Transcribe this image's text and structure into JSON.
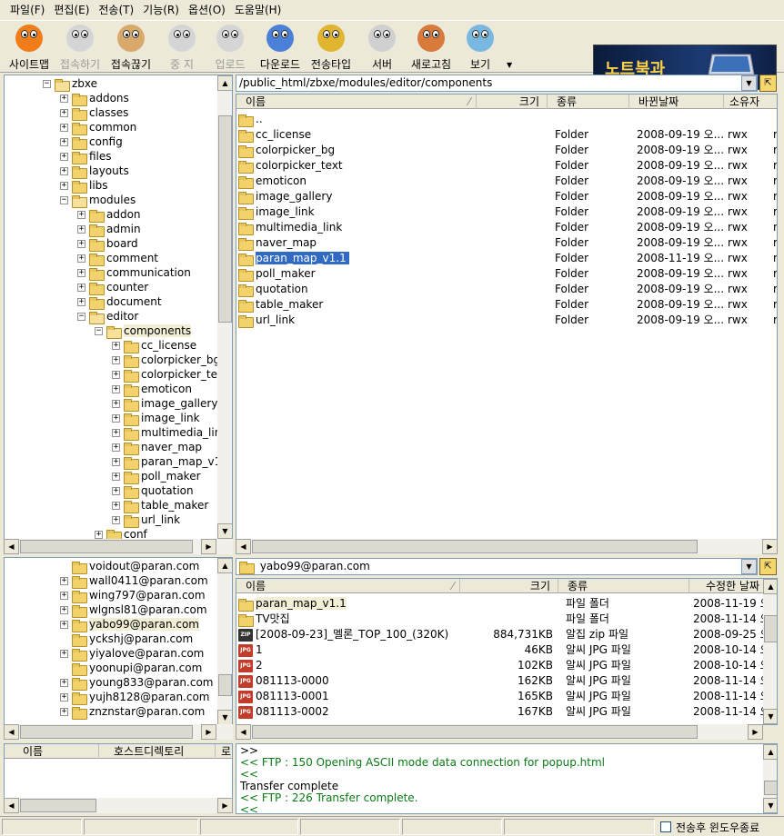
{
  "menu": [
    "파일(F)",
    "편집(E)",
    "전송(T)",
    "기능(R)",
    "옵션(O)",
    "도움말(H)"
  ],
  "toolbar": {
    "buttons": [
      {
        "label": "사이트맵",
        "color": "#f07c1a",
        "disabled": false
      },
      {
        "label": "접속하기",
        "color": "#9a9a9a",
        "disabled": true
      },
      {
        "label": "접속끊기",
        "color": "#d9a86b",
        "disabled": false
      },
      {
        "label": "중 지",
        "color": "#9a9a9a",
        "disabled": true
      },
      {
        "label": "업로드",
        "color": "#9a9a9a",
        "disabled": true
      },
      {
        "label": "다운로드",
        "color": "#4a80d8",
        "disabled": false
      },
      {
        "label": "전송타입",
        "color": "#e2b530",
        "disabled": false
      },
      {
        "label": "서버",
        "color": "#d0d0d0",
        "disabled": false
      },
      {
        "label": "새로고침",
        "color": "#d77a3c",
        "disabled": false
      },
      {
        "label": "보기",
        "color": "#79b8e0",
        "disabled": false
      }
    ],
    "banner_text": "노트북과"
  },
  "remote_tree": [
    {
      "label": "zbxe",
      "expanded": true,
      "twisty": "−"
    },
    {
      "label": "addons",
      "twisty": "+"
    },
    {
      "label": "classes",
      "twisty": "+"
    },
    {
      "label": "common",
      "twisty": "+"
    },
    {
      "label": "config",
      "twisty": "+"
    },
    {
      "label": "files",
      "twisty": "+"
    },
    {
      "label": "layouts",
      "twisty": "+"
    },
    {
      "label": "libs",
      "twisty": "+"
    },
    {
      "label": "modules",
      "twisty": "−"
    },
    {
      "label": "addon",
      "twisty": "+"
    },
    {
      "label": "admin",
      "twisty": "+"
    },
    {
      "label": "board",
      "twisty": "+"
    },
    {
      "label": "comment",
      "twisty": "+"
    },
    {
      "label": "communication",
      "twisty": "+"
    },
    {
      "label": "counter",
      "twisty": "+"
    },
    {
      "label": "document",
      "twisty": "+"
    },
    {
      "label": "editor",
      "twisty": "−"
    },
    {
      "label": "components",
      "twisty": "−"
    },
    {
      "label": "cc_license",
      "twisty": "+"
    },
    {
      "label": "colorpicker_bg",
      "twisty": "+"
    },
    {
      "label": "colorpicker_te",
      "twisty": "+"
    },
    {
      "label": "emoticon",
      "twisty": "+"
    },
    {
      "label": "image_gallery",
      "twisty": "+"
    },
    {
      "label": "image_link",
      "twisty": "+"
    },
    {
      "label": "multimedia_lir",
      "twisty": "+"
    },
    {
      "label": "naver_map",
      "twisty": "+"
    },
    {
      "label": "paran_map_v1",
      "twisty": "+"
    },
    {
      "label": "poll_maker",
      "twisty": "+"
    },
    {
      "label": "quotation",
      "twisty": "+"
    },
    {
      "label": "table_maker",
      "twisty": "+"
    },
    {
      "label": "url_link",
      "twisty": "+"
    },
    {
      "label": "conf",
      "twisty": "+"
    }
  ],
  "remote_path": "/public_html/zbxe/modules/editor/components",
  "remote_headers": [
    "이름",
    "크기",
    "종류",
    "바뀐날짜",
    "소유자"
  ],
  "remote_files": [
    {
      "name": "..",
      "type": "",
      "date": "",
      "perm": "",
      "extra": ""
    },
    {
      "name": "cc_license",
      "type": "Folder",
      "date": "2008-09-19 오...",
      "perm": "rwx",
      "extra": "r-"
    },
    {
      "name": "colorpicker_bg",
      "type": "Folder",
      "date": "2008-09-19 오...",
      "perm": "rwx",
      "extra": "r-"
    },
    {
      "name": "colorpicker_text",
      "type": "Folder",
      "date": "2008-09-19 오...",
      "perm": "rwx",
      "extra": "r-"
    },
    {
      "name": "emoticon",
      "type": "Folder",
      "date": "2008-09-19 오...",
      "perm": "rwx",
      "extra": "r-"
    },
    {
      "name": "image_gallery",
      "type": "Folder",
      "date": "2008-09-19 오...",
      "perm": "rwx",
      "extra": "r-"
    },
    {
      "name": "image_link",
      "type": "Folder",
      "date": "2008-09-19 오...",
      "perm": "rwx",
      "extra": "r-"
    },
    {
      "name": "multimedia_link",
      "type": "Folder",
      "date": "2008-09-19 오...",
      "perm": "rwx",
      "extra": "r-"
    },
    {
      "name": "naver_map",
      "type": "Folder",
      "date": "2008-09-19 오...",
      "perm": "rwx",
      "extra": "r-"
    },
    {
      "name": "paran_map_v1.1",
      "type": "Folder",
      "date": "2008-11-19 오...",
      "perm": "rwx",
      "extra": "r-"
    },
    {
      "name": "poll_maker",
      "type": "Folder",
      "date": "2008-09-19 오...",
      "perm": "rwx",
      "extra": "r-"
    },
    {
      "name": "quotation",
      "type": "Folder",
      "date": "2008-09-19 오...",
      "perm": "rwx",
      "extra": "r-"
    },
    {
      "name": "table_maker",
      "type": "Folder",
      "date": "2008-09-19 오...",
      "perm": "rwx",
      "extra": "r-"
    },
    {
      "name": "url_link",
      "type": "Folder",
      "date": "2008-09-19 오...",
      "perm": "rwx",
      "extra": "r-"
    }
  ],
  "remote_selected": 9,
  "local_tree": [
    {
      "label": "voidout@paran.com",
      "twisty": ""
    },
    {
      "label": "wall0411@paran.com",
      "twisty": "+"
    },
    {
      "label": "wing797@paran.com",
      "twisty": "+"
    },
    {
      "label": "wlgnsl81@paran.com",
      "twisty": "+"
    },
    {
      "label": "yabo99@paran.com",
      "twisty": "+"
    },
    {
      "label": "yckshj@paran.com",
      "twisty": ""
    },
    {
      "label": "yiyalove@paran.com",
      "twisty": "+"
    },
    {
      "label": "yoonupi@paran.com",
      "twisty": ""
    },
    {
      "label": "young833@paran.com",
      "twisty": "+"
    },
    {
      "label": "yujh8128@paran.com",
      "twisty": "+"
    },
    {
      "label": "znznstar@paran.com",
      "twisty": "+"
    }
  ],
  "local_selected": 4,
  "local_path": "yabo99@paran.com",
  "local_headers": [
    "이름",
    "크기",
    "종류",
    "수정한 날짜"
  ],
  "local_files": [
    {
      "name": "paran_map_v1.1",
      "icon": "folder",
      "size": "",
      "type": "파일 폴더",
      "date": "2008-11-19 오"
    },
    {
      "name": "TV맛집",
      "icon": "folder",
      "size": "",
      "type": "파일 폴더",
      "date": "2008-11-14 오"
    },
    {
      "name": "[2008-09-23]_멜론_TOP_100_(320K)",
      "icon": "zip",
      "size": "884,731KB",
      "type": "알집 zip 파일",
      "date": "2008-09-25 오"
    },
    {
      "name": "1",
      "icon": "jpg",
      "size": "46KB",
      "type": "알씨 JPG 파일",
      "date": "2008-10-14 오"
    },
    {
      "name": "2",
      "icon": "jpg",
      "size": "102KB",
      "type": "알씨 JPG 파일",
      "date": "2008-10-14 오"
    },
    {
      "name": "081113-0000",
      "icon": "jpg",
      "size": "162KB",
      "type": "알씨 JPG 파일",
      "date": "2008-11-14 오"
    },
    {
      "name": "081113-0001",
      "icon": "jpg",
      "size": "165KB",
      "type": "알씨 JPG 파일",
      "date": "2008-11-14 오"
    },
    {
      "name": "081113-0002",
      "icon": "jpg",
      "size": "167KB",
      "type": "알씨 JPG 파일",
      "date": "2008-11-14 오"
    }
  ],
  "queue_headers": [
    "이름",
    "호스트디렉토리",
    "로"
  ],
  "log": [
    {
      "text": ">>",
      "green": false
    },
    {
      "text": "<< FTP : 150 Opening ASCII mode data connection for popup.html",
      "green": true
    },
    {
      "text": "<<",
      "green": true
    },
    {
      "text": "Transfer complete",
      "green": false
    },
    {
      "text": "<< FTP : 226 Transfer complete.",
      "green": true
    },
    {
      "text": "<<",
      "green": true
    }
  ],
  "status": {
    "checkbox_label": "전송후 윈도우종료"
  },
  "icons": {
    "dropdown": "▼",
    "up_arrow": "▲",
    "left_arrow": "◀",
    "right_arrow": "▶",
    "folder_up": "⇱"
  }
}
